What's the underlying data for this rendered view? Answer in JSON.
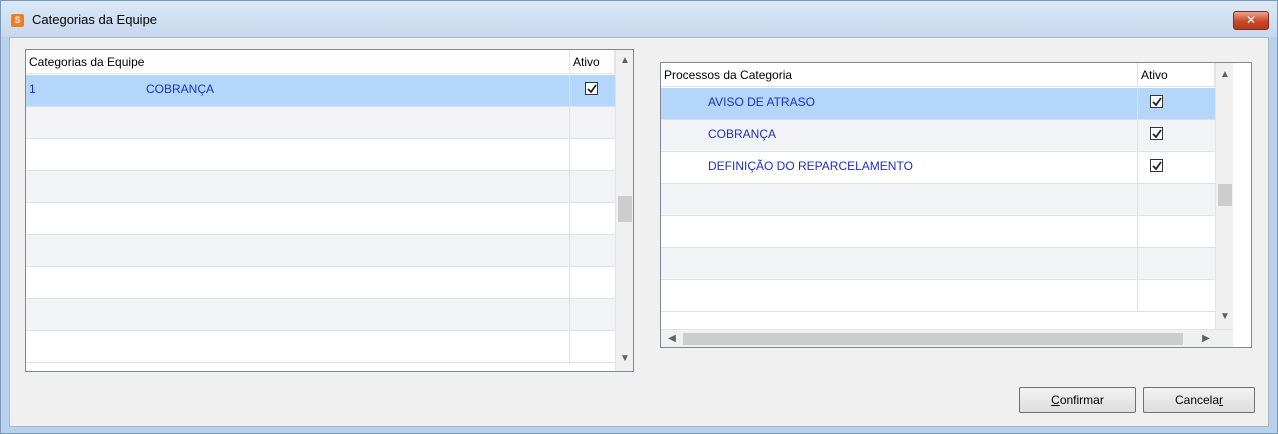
{
  "window": {
    "title": "Categorias da Equipe",
    "close_label": "✕"
  },
  "left_grid": {
    "columns": [
      "Categorias da Equipe",
      "Ativo"
    ],
    "rows": [
      {
        "id": "1",
        "name": "COBRANÇA",
        "ativo": true
      }
    ]
  },
  "right_grid": {
    "columns": [
      "Processos da Categoria",
      "Ativo"
    ],
    "rows": [
      {
        "name": "AVISO DE ATRASO",
        "ativo": true
      },
      {
        "name": "COBRANÇA",
        "ativo": true
      },
      {
        "name": "DEFINIÇÃO DO REPARCELAMENTO",
        "ativo": true
      }
    ]
  },
  "buttons": {
    "confirm_first": "C",
    "confirm_rest": "onfirmar",
    "cancel_main": "Cancela",
    "cancel_last": "r"
  },
  "colors": {
    "selected_row": "#b3d6fa",
    "text_blue": "#1d2fc4"
  }
}
